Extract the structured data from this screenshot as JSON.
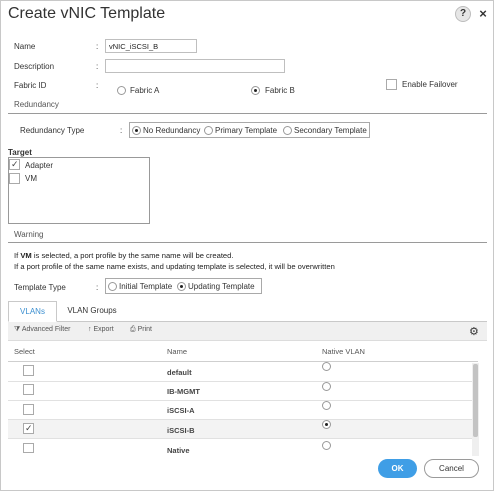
{
  "dialog": {
    "title": "Create vNIC Template",
    "help_glyph": "?",
    "close_glyph": "×"
  },
  "form": {
    "name": {
      "label": "Name",
      "value": "vNIC_iSCSI_B"
    },
    "description": {
      "label": "Description",
      "value": ""
    },
    "fabric_id": {
      "label": "Fabric ID",
      "options": [
        "Fabric A",
        "Fabric B"
      ],
      "selected": "Fabric B"
    },
    "enable_failover": {
      "label": "Enable Failover",
      "checked": false
    },
    "colon": ":"
  },
  "redundancy": {
    "section_title": "Redundancy",
    "type_label": "Redundancy Type",
    "options": [
      "No Redundancy",
      "Primary Template",
      "Secondary Template"
    ],
    "selected": "No Redundancy"
  },
  "target": {
    "label": "Target",
    "items": [
      {
        "label": "Adapter",
        "checked": true
      },
      {
        "label": "VM",
        "checked": false
      }
    ]
  },
  "warning": {
    "section_title": "Warning",
    "line1_prefix": "If ",
    "line1_bold": "VM",
    "line1_suffix": " is selected, a port profile by the same name will be created.",
    "line2": "If a port profile of the same name exists, and updating template is selected, it will be overwritten"
  },
  "template_type": {
    "label": "Template Type",
    "options": [
      "Initial Template",
      "Updating Template"
    ],
    "selected": "Updating Template"
  },
  "tabs": [
    {
      "label": "VLANs",
      "active": true
    },
    {
      "label": "VLAN Groups",
      "active": false
    }
  ],
  "toolbar": {
    "advanced_filter": "Advanced Filter",
    "export": "Export",
    "print": "Print"
  },
  "vlan_table": {
    "columns": [
      "Select",
      "Name",
      "Native VLAN"
    ],
    "rows": [
      {
        "name": "default",
        "selected": false,
        "native": false
      },
      {
        "name": "IB-MGMT",
        "selected": false,
        "native": false
      },
      {
        "name": "iSCSI-A",
        "selected": false,
        "native": false
      },
      {
        "name": "iSCSI-B",
        "selected": true,
        "native": true
      },
      {
        "name": "Native",
        "selected": false,
        "native": false
      }
    ]
  },
  "buttons": {
    "ok": "OK",
    "cancel": "Cancel"
  },
  "colors": {
    "accent": "#3f9ee6",
    "tab_active": "#3b8fd0"
  }
}
